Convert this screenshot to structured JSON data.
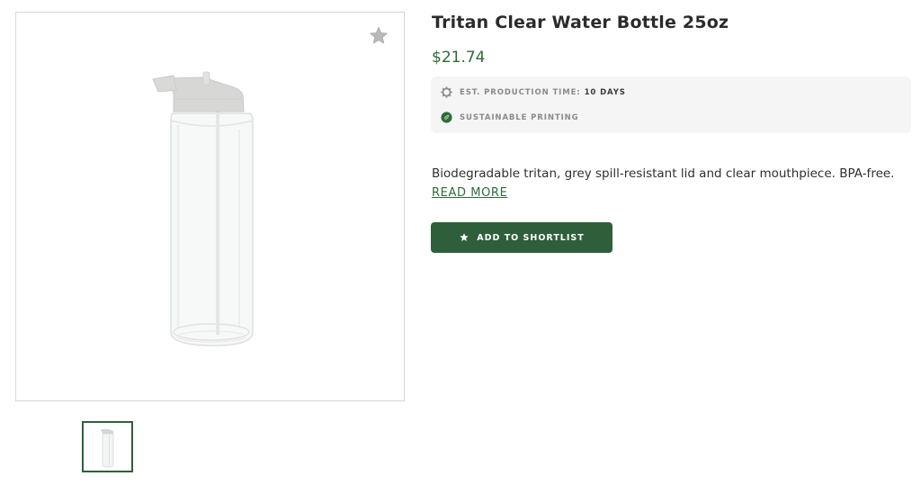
{
  "product": {
    "title": "Tritan Clear Water Bottle 25oz",
    "price": "$21.74",
    "image_alt": "Clear tritan water bottle with grey lid"
  },
  "info": {
    "production_label": "EST. PRODUCTION TIME:",
    "production_value": "10 DAYS",
    "sustainable_label": "SUSTAINABLE PRINTING"
  },
  "description": {
    "text": "Biodegradable tritan, grey spill-resistant lid and clear mouthpiece. BPA-free.",
    "read_more": "READ MORE"
  },
  "actions": {
    "shortlist_label": "ADD TO SHORTLIST"
  },
  "icons": {
    "favorite": "star-icon",
    "production": "gear-icon",
    "sustainable": "leaf-icon",
    "button": "star-icon"
  },
  "colors": {
    "brand_green": "#2f5f3a",
    "price_green": "#2f6b3a",
    "info_bg": "#f5f5f5",
    "thumb_border": "#2f5f3a"
  }
}
